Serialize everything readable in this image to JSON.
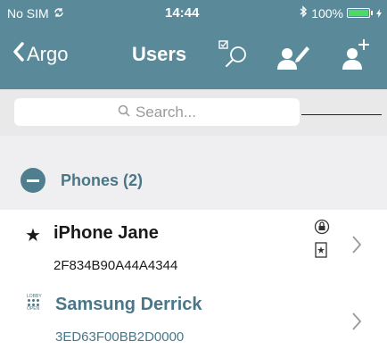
{
  "status": {
    "carrier": "No SIM",
    "time": "14:44",
    "battery": "100%"
  },
  "nav": {
    "back_label": "Argo",
    "title": "Users"
  },
  "search": {
    "placeholder": "Search..."
  },
  "section": {
    "title": "Phones (2)"
  },
  "rows": [
    {
      "name": "iPhone Jane",
      "id": "2F834B90A44A4344"
    },
    {
      "name": "Samsung Derrick",
      "id": "3ED63F00BB2D0000",
      "badge_top": "LOBBY",
      "badge_bottom": "OPEN"
    }
  ],
  "colors": {
    "bar": "#5a8a99",
    "accent": "#4a7787",
    "battery": "#4cd964"
  }
}
